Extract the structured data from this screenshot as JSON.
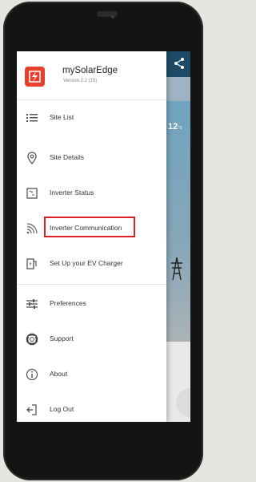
{
  "app": {
    "name": "mySolarEdge",
    "version": "Version 2.2 (15)"
  },
  "menu": [
    {
      "key": "site-list",
      "label": "Site List",
      "icon": "list-icon"
    },
    {
      "key": "site-details",
      "label": "Site Details",
      "icon": "location-pin-icon"
    },
    {
      "key": "inverter-status",
      "label": "Inverter Status",
      "icon": "inverter-icon"
    },
    {
      "key": "inverter-communication",
      "label": "Inverter Communication",
      "icon": "signal-icon",
      "highlighted": true
    },
    {
      "key": "ev-charger",
      "label": "Set Up your EV Charger",
      "icon": "ev-charger-icon"
    },
    {
      "key": "preferences",
      "label": "Preferences",
      "icon": "sliders-icon"
    },
    {
      "key": "support",
      "label": "Support",
      "icon": "lifebuoy-icon"
    },
    {
      "key": "about",
      "label": "About",
      "icon": "info-icon"
    },
    {
      "key": "log-out",
      "label": "Log Out",
      "icon": "logout-icon"
    }
  ],
  "background": {
    "temperature": "12",
    "temperature_unit": "°c"
  },
  "colors": {
    "brand": "#e8402f",
    "highlight": "#e02020",
    "header_bg": "#1f4a66"
  }
}
